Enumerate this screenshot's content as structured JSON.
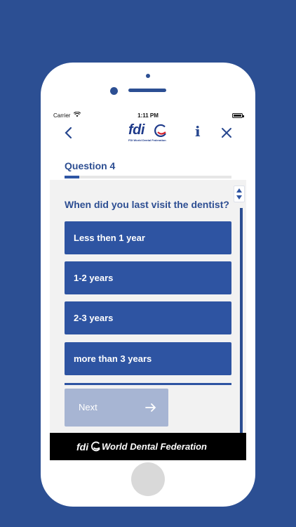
{
  "status_bar": {
    "carrier": "Carrier",
    "time": "1:11 PM"
  },
  "header": {
    "logo_text": "fdi",
    "logo_subtitle": "FDI World Dental Federation",
    "back_icon": "chevron-left-icon",
    "info_label": "i",
    "close_icon": "close-icon"
  },
  "quiz": {
    "title": "Question 4",
    "progress_fraction": 0.09,
    "question": "When did you last visit the dentist?",
    "options": [
      {
        "label": "Less then 1 year"
      },
      {
        "label": "1-2 years"
      },
      {
        "label": "2-3 years"
      },
      {
        "label": "more than 3 years"
      }
    ],
    "next_label": "Next"
  },
  "footer": {
    "logo_text": "fdi",
    "name": "World Dental Federation"
  },
  "colors": {
    "background": "#2c4f93",
    "option": "#2e54a2",
    "next_disabled": "#a7b5d3",
    "title_text": "#2d4e92"
  }
}
